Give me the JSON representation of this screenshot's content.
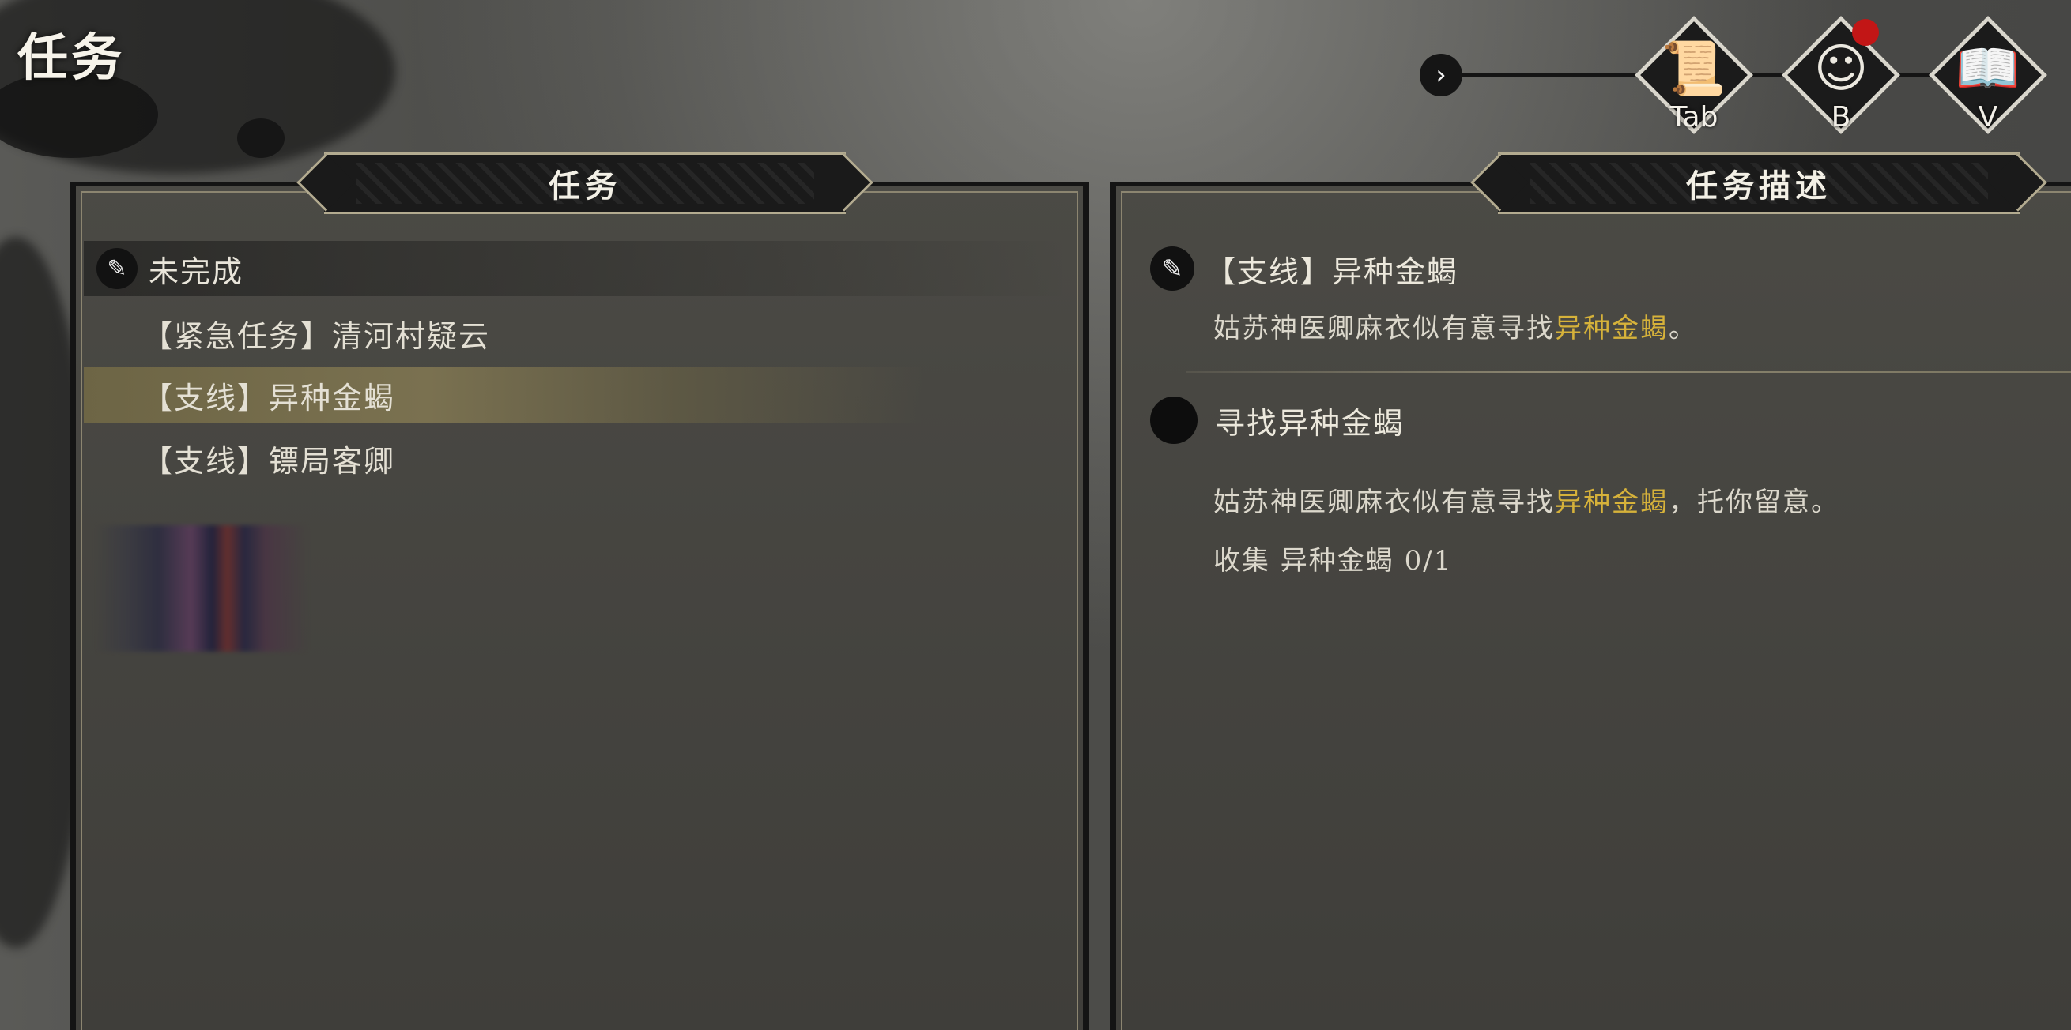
{
  "page_title": "任务",
  "nav": {
    "arrow_glyph": "›",
    "buttons": [
      {
        "name": "quest-scroll",
        "icon": "scroll-icon",
        "glyph": "📜",
        "key": "Tab"
      },
      {
        "name": "character",
        "icon": "character-icon",
        "glyph": "☺",
        "key": "B",
        "notification": true
      },
      {
        "name": "book",
        "icon": "book-icon",
        "glyph": "📖",
        "key": "V"
      }
    ]
  },
  "quest_panel": {
    "title": "任务",
    "section_label": "未完成",
    "quests": [
      {
        "label": "【紧急任务】清河村疑云",
        "selected": false
      },
      {
        "label": "【支线】异种金蝎",
        "selected": true
      },
      {
        "label": "【支线】镖局客卿",
        "selected": false
      }
    ]
  },
  "description_panel": {
    "title": "任务描述",
    "quest_title": "【支线】异种金蝎",
    "summary_prefix": "姑苏神医卿麻衣似有意寻找",
    "summary_highlight": "异种金蝎",
    "summary_suffix": "。",
    "objective_title": "寻找异种金蝎",
    "objective_prefix": "姑苏神医卿麻衣似有意寻找",
    "objective_highlight": "异种金蝎",
    "objective_suffix": "，托你留意。",
    "progress_text": "收集 异种金蝎 0/1"
  },
  "colors": {
    "highlight": "#d6b23a",
    "notification": "#c21616",
    "selected_row": "#7a7150"
  }
}
